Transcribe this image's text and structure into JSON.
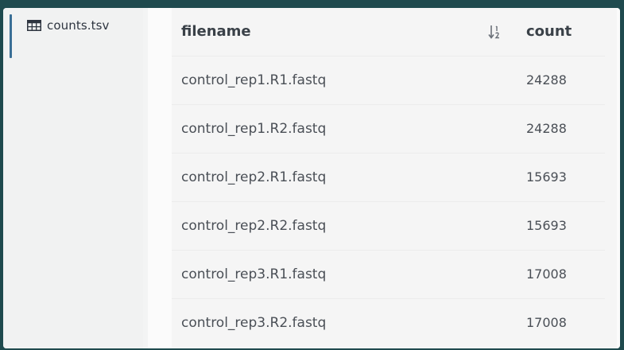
{
  "sidebar": {
    "file": {
      "icon": "table-icon",
      "label": "counts.tsv"
    }
  },
  "table": {
    "headers": {
      "filename": "filename",
      "count": "count"
    },
    "sort_icon": "sort-descending-icon",
    "rows": [
      {
        "filename": "control_rep1.R1.fastq",
        "count": "24288"
      },
      {
        "filename": "control_rep1.R2.fastq",
        "count": "24288"
      },
      {
        "filename": "control_rep2.R1.fastq",
        "count": "15693"
      },
      {
        "filename": "control_rep2.R2.fastq",
        "count": "15693"
      },
      {
        "filename": "control_rep3.R1.fastq",
        "count": "17008"
      },
      {
        "filename": "control_rep3.R2.fastq",
        "count": "17008"
      }
    ]
  },
  "colors": {
    "background": "#1f4a4e",
    "active_indicator": "#3a6f96",
    "header_text": "#3a4148",
    "cell_text": "#4a4f56"
  }
}
